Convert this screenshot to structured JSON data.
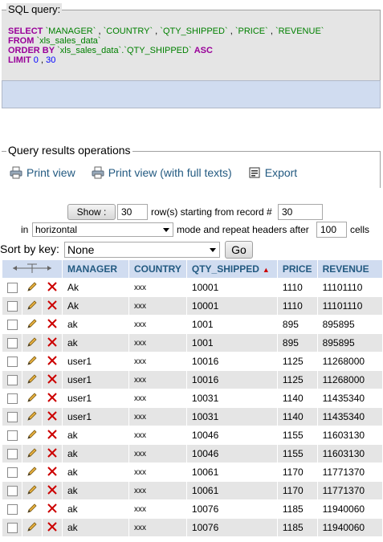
{
  "sql_box": {
    "legend": "SQL query:",
    "line1": {
      "kw": "SELECT",
      "cols": [
        "`MANAGER`",
        "`COUNTRY`",
        "`QTY_SHIPPED`",
        "`PRICE`",
        "`REVENUE`"
      ]
    },
    "line2": {
      "kw": "FROM",
      "table": "`xls_sales_data`"
    },
    "line3": {
      "kw": "ORDER BY",
      "col": "`xls_sales_data`.`QTY_SHIPPED`",
      "dir": "ASC"
    },
    "line4": {
      "kw": "LIMIT",
      "a": "0",
      "b": "30"
    }
  },
  "ops": {
    "legend": "Query results operations",
    "print_view": "Print view",
    "print_view_full": "Print view (with full texts)",
    "export": "Export"
  },
  "nav": {
    "show_label": "Show :",
    "rows_value": "30",
    "rows_text": "row(s) starting from record #",
    "start_value": "30",
    "in_text": "in",
    "mode_value": "horizontal",
    "mode_text": "mode and repeat headers after",
    "headers_value": "100",
    "cells_text": "cells",
    "sort_label": "Sort by key:",
    "sort_value": "None",
    "go_label": "Go"
  },
  "table": {
    "columns": [
      "MANAGER",
      "COUNTRY",
      "QTY_SHIPPED",
      "PRICE",
      "REVENUE"
    ],
    "sorted_column": "QTY_SHIPPED",
    "rows": [
      [
        "Ak",
        "xxx",
        "10001",
        "1110",
        "11101110"
      ],
      [
        "Ak",
        "xxx",
        "10001",
        "1110",
        "11101110"
      ],
      [
        "ak",
        "xxx",
        "1001",
        "895",
        "895895"
      ],
      [
        "ak",
        "xxx",
        "1001",
        "895",
        "895895"
      ],
      [
        "user1",
        "xxx",
        "10016",
        "1125",
        "11268000"
      ],
      [
        "user1",
        "xxx",
        "10016",
        "1125",
        "11268000"
      ],
      [
        "user1",
        "xxx",
        "10031",
        "1140",
        "11435340"
      ],
      [
        "user1",
        "xxx",
        "10031",
        "1140",
        "11435340"
      ],
      [
        "ak",
        "xxx",
        "10046",
        "1155",
        "11603130"
      ],
      [
        "ak",
        "xxx",
        "10046",
        "1155",
        "11603130"
      ],
      [
        "ak",
        "xxx",
        "10061",
        "1170",
        "11771370"
      ],
      [
        "ak",
        "xxx",
        "10061",
        "1170",
        "11771370"
      ],
      [
        "ak",
        "xxx",
        "10076",
        "1185",
        "11940060"
      ],
      [
        "ak",
        "xxx",
        "10076",
        "1185",
        "11940060"
      ]
    ]
  },
  "colors": {
    "header_bg": "#d0dcf0",
    "link": "#235a81",
    "even_row": "#e5e5e5",
    "delete": "#cc0000",
    "keyword": "#990099"
  }
}
